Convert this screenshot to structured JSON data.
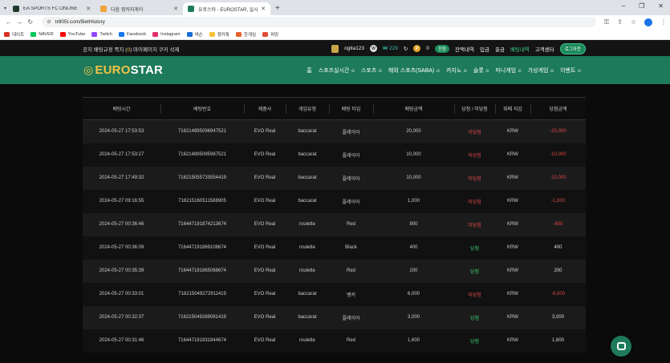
{
  "browser": {
    "tabs": [
      {
        "title": "EA SPORTS FC ONLINE",
        "fav_color": "#1d3a2a"
      },
      {
        "title": "다음 영카지게이",
        "fav_color": "#f2a33a"
      },
      {
        "title": "유로스타 - EUROSTAR, 실시간",
        "fav_color": "#1d7a5a"
      }
    ],
    "url": "tr805l.com/BetHistory",
    "bookmarks": [
      {
        "label": "대이트",
        "color": "#d93025"
      },
      {
        "label": "NAVER",
        "color": "#03c75a"
      },
      {
        "label": "YouTube",
        "color": "#ff0000"
      },
      {
        "label": "Twitch",
        "color": "#9146ff"
      },
      {
        "label": "Facebook",
        "color": "#1877f2"
      },
      {
        "label": "Instagram",
        "color": "#e1306c"
      },
      {
        "label": "넥슨",
        "color": "#1a6bd6"
      },
      {
        "label": "쟁카톡",
        "color": "#f6c338"
      },
      {
        "label": "한게임",
        "color": "#e8612c"
      },
      {
        "label": "피망",
        "color": "#e44b3a"
      }
    ]
  },
  "site": {
    "notice": {
      "prefix": "공지 배팅규정 ",
      "mid": "쪽지 (",
      "count": "0",
      "suffix": ") 마이페이지 쿠키 삭제"
    },
    "user": {
      "name": "ogita123",
      "money": "₩ 229",
      "coin_label": "W",
      "points": "0",
      "point_label": "P",
      "convert_label": "전환",
      "links": [
        "잔액내역",
        "입금",
        "출금"
      ],
      "bet_history_label": "배팅내역",
      "support_label": "고객센터",
      "logout_label": "로그아웃"
    },
    "logo": {
      "accent": "EURO",
      "rest": "STAR",
      "mark": "◎"
    },
    "menu": [
      "홈",
      "스포츠실시간",
      "스포츠",
      "해외 스포츠(SABA)",
      "카지노",
      "슬롯",
      "미니게임",
      "가상게임",
      "이벤트"
    ]
  },
  "table": {
    "headers": [
      "배팅시간",
      "배팅번호",
      "제품사",
      "게임유형",
      "배팅 타입",
      "배팅금액",
      "당첨 / 미당첨",
      "화폐 지갑",
      "당첨금액"
    ],
    "rows": [
      {
        "time": "2024-05-27 17:53:53",
        "id": "716214895096947521",
        "vendor": "EVO Real",
        "game": "baccarat",
        "bet_type": "플레이어",
        "amount": "20,000",
        "status": "미당첨",
        "win": false,
        "wallet": "KRW",
        "payout": "-20,000"
      },
      {
        "time": "2024-05-27 17:53:27",
        "id": "716214895095987521",
        "vendor": "EVO Real",
        "game": "baccarat",
        "bet_type": "플레이어",
        "amount": "10,000",
        "status": "미당첨",
        "win": false,
        "wallet": "KRW",
        "payout": "-10,000"
      },
      {
        "time": "2024-05-27 17:49:32",
        "id": "716215055733554419",
        "vendor": "EVO Real",
        "game": "baccarat",
        "bet_type": "플레이어",
        "amount": "10,000",
        "status": "미당첨",
        "win": false,
        "wallet": "KRW",
        "payout": "-10,000"
      },
      {
        "time": "2024-05-27 09:16:55",
        "id": "716215160511588905",
        "vendor": "EVO Real",
        "game": "baccarat",
        "bet_type": "플레이어",
        "amount": "1,000",
        "status": "미당첨",
        "win": false,
        "wallet": "KRW",
        "payout": "-1,000"
      },
      {
        "time": "2024-05-27 00:36:46",
        "id": "716447191874213674",
        "vendor": "EVO Real",
        "game": "roulette",
        "bet_type": "Red",
        "amount": "800",
        "status": "미당첨",
        "win": false,
        "wallet": "KRW",
        "payout": "-800"
      },
      {
        "time": "2024-05-27 00:36:09",
        "id": "716447191869108674",
        "vendor": "EVO Real",
        "game": "roulette",
        "bet_type": "Black",
        "amount": "400",
        "status": "당첨",
        "win": true,
        "wallet": "KRW",
        "payout": "400"
      },
      {
        "time": "2024-05-27 00:35:39",
        "id": "716447191865068674",
        "vendor": "EVO Real",
        "game": "roulette",
        "bet_type": "Red",
        "amount": "200",
        "status": "당첨",
        "win": true,
        "wallet": "KRW",
        "payout": "200"
      },
      {
        "time": "2024-05-27 00:33:01",
        "id": "716215049272911419",
        "vendor": "EVO Real",
        "game": "baccarat",
        "bet_type": "뱅커",
        "amount": "6,000",
        "status": "미당첨",
        "win": false,
        "wallet": "KRW",
        "payout": "-6,000"
      },
      {
        "time": "2024-05-27 00:32:37",
        "id": "716215049269061419",
        "vendor": "EVO Real",
        "game": "baccarat",
        "bet_type": "플레이어",
        "amount": "3,000",
        "status": "당첨",
        "win": true,
        "wallet": "KRW",
        "payout": "3,000"
      },
      {
        "time": "2024-05-27 00:31:46",
        "id": "716447191831844674",
        "vendor": "EVO Real",
        "game": "roulette",
        "bet_type": "Red",
        "amount": "1,600",
        "status": "당첨",
        "win": true,
        "wallet": "KRW",
        "payout": "1,600"
      }
    ]
  },
  "colors": {
    "brand_green": "#1d7a5a",
    "lose_red": "#e04848",
    "win_green": "#3bd16a",
    "accent_gold": "#f3c246"
  }
}
